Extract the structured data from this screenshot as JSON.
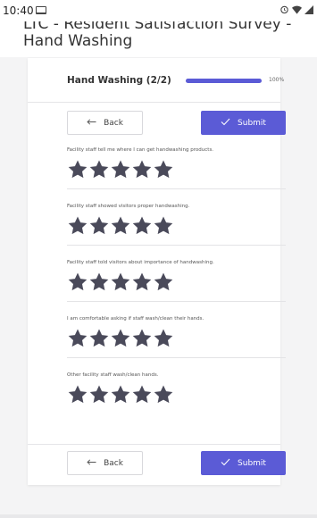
{
  "status_bar": {
    "time": "10:40",
    "icons": [
      "notification-icon",
      "alarm-icon",
      "wifi-icon",
      "signal-icon"
    ]
  },
  "header": {
    "title": "LTC - Resident Satisfaction Survey - Hand Washing"
  },
  "card": {
    "title": "Hand Washing (2/2)",
    "progress_percent": 100,
    "progress_label": "100%"
  },
  "nav": {
    "back_label": "Back",
    "submit_label": "Submit"
  },
  "questions": [
    {
      "text": "Facility staff tell me where I can get handwashing products.",
      "rating": 5,
      "max": 5
    },
    {
      "text": "Facility staff showed visitors proper handwashing.",
      "rating": 5,
      "max": 5
    },
    {
      "text": "Facility staff told visitors about importance of handwashing.",
      "rating": 5,
      "max": 5
    },
    {
      "text": "I am comfortable asking if staff wash/clean their hands.",
      "rating": 5,
      "max": 5
    },
    {
      "text": "Other facility staff wash/clean hands.",
      "rating": 5,
      "max": 5
    }
  ],
  "colors": {
    "accent": "#5b5bd6",
    "star": "#4a4a5a"
  }
}
